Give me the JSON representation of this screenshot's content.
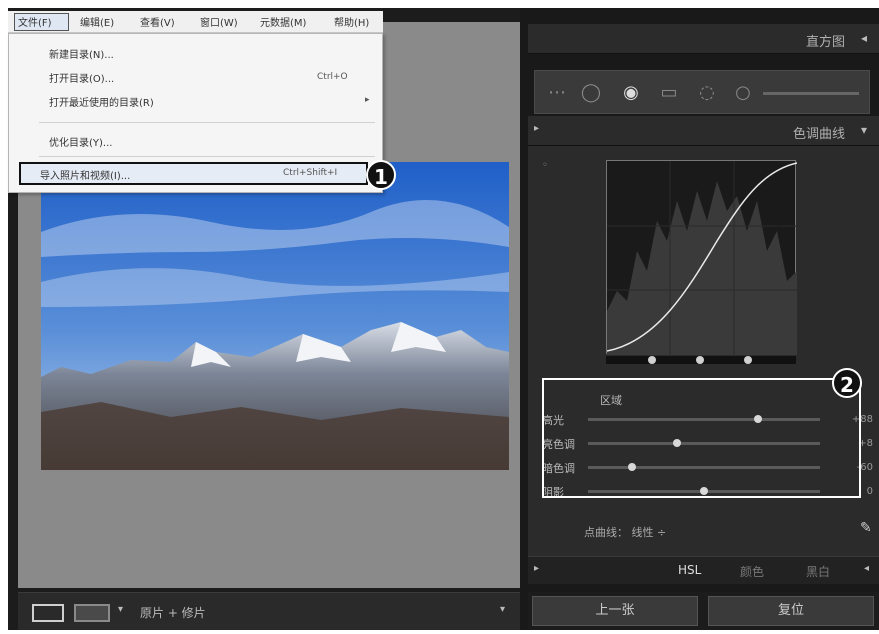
{
  "menubar": {
    "items": [
      "文件(F)",
      "编辑(E)",
      "查看(V)",
      "窗口(W)",
      "元数据(M)",
      "帮助(H)"
    ]
  },
  "file_menu": {
    "items": [
      {
        "label": "新建目录(N)...",
        "shortcut": ""
      },
      {
        "label": "打开目录(O)...",
        "shortcut": "Ctrl+O"
      },
      {
        "label": "打开最近使用的目录(R)",
        "shortcut": "▸"
      },
      {
        "label": "优化目录(Y)...",
        "shortcut": ""
      },
      {
        "label": "导入照片和视频(I)...",
        "shortcut": "Ctrl+Shift+I"
      }
    ]
  },
  "callouts": {
    "one": "1",
    "two": "2"
  },
  "filmstrip": {
    "label": "原片 + 修片"
  },
  "right_panel": {
    "histogram_title": "直方图",
    "tone_curve_title": "色调曲线",
    "region_label": "区域",
    "sliders": [
      {
        "label": "高光",
        "value": "+88",
        "fraction": 0.74
      },
      {
        "label": "亮色调",
        "value": "+8",
        "fraction": 0.38
      },
      {
        "label": "暗色调",
        "value": "-60",
        "fraction": 0.18
      },
      {
        "label": "阴影",
        "value": "0",
        "fraction": 0.5
      }
    ],
    "channel_text": "点曲线：  线性 ÷",
    "tabs": [
      "HSL",
      "颜色",
      "黑白"
    ],
    "buttons": {
      "prev": "上一张",
      "reset": "复位"
    }
  },
  "colors": {
    "accent_highlight": "#ffffff",
    "callout_bg": "#111111"
  }
}
